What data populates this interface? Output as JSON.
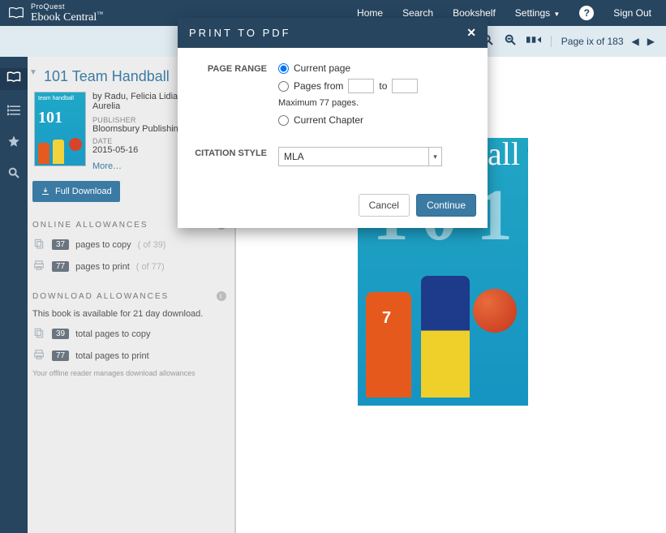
{
  "header": {
    "brand_small": "ProQuest",
    "brand_main": "Ebook Central",
    "nav": {
      "home": "Home",
      "search": "Search",
      "bookshelf": "Bookshelf",
      "settings": "Settings",
      "signout": "Sign Out"
    }
  },
  "toolbar": {
    "page_indicator": "Page ix of 183"
  },
  "sidebar": {
    "title": "101 Team Handball",
    "byline": "by Radu, Felicia Lidia Ab Beatrice Aurelia",
    "publisher_label": "PUBLISHER",
    "publisher": "Bloomsbury Publishing",
    "date_label": "DATE",
    "date": "2015-05-16",
    "more": "More…",
    "full_download": "Full Download",
    "thumb_tag": "team handball",
    "thumb_num": "101",
    "online_allow_head": "ONLINE ALLOWANCES",
    "copy": {
      "count": "37",
      "label": "pages to copy",
      "of": "( of 39)"
    },
    "print": {
      "count": "77",
      "label": "pages to print",
      "of": "( of 77)"
    },
    "download_allow_head": "DOWNLOAD ALLOWANCES",
    "dl_note": "This book is available for 21 day download.",
    "dl_copy": {
      "count": "39",
      "label": "total pages to copy"
    },
    "dl_print": {
      "count": "77",
      "label": "total pages to print"
    },
    "offline_note": "Your offline reader manages download allowances"
  },
  "modal": {
    "title": "PRINT TO PDF",
    "labels": {
      "page_range": "PAGE RANGE",
      "citation_style": "CITATION STYLE"
    },
    "options": {
      "current_page": "Current page",
      "pages_from": "Pages from",
      "to": "to",
      "max_note": "Maximum 77 pages.",
      "current_chapter": "Current Chapter"
    },
    "citation_value": "MLA",
    "buttons": {
      "cancel": "Cancel",
      "continue": "Continue"
    }
  },
  "page_image": {
    "title_fragment": "ball",
    "jersey": "7",
    "digits": [
      "1",
      "0",
      "1"
    ]
  }
}
